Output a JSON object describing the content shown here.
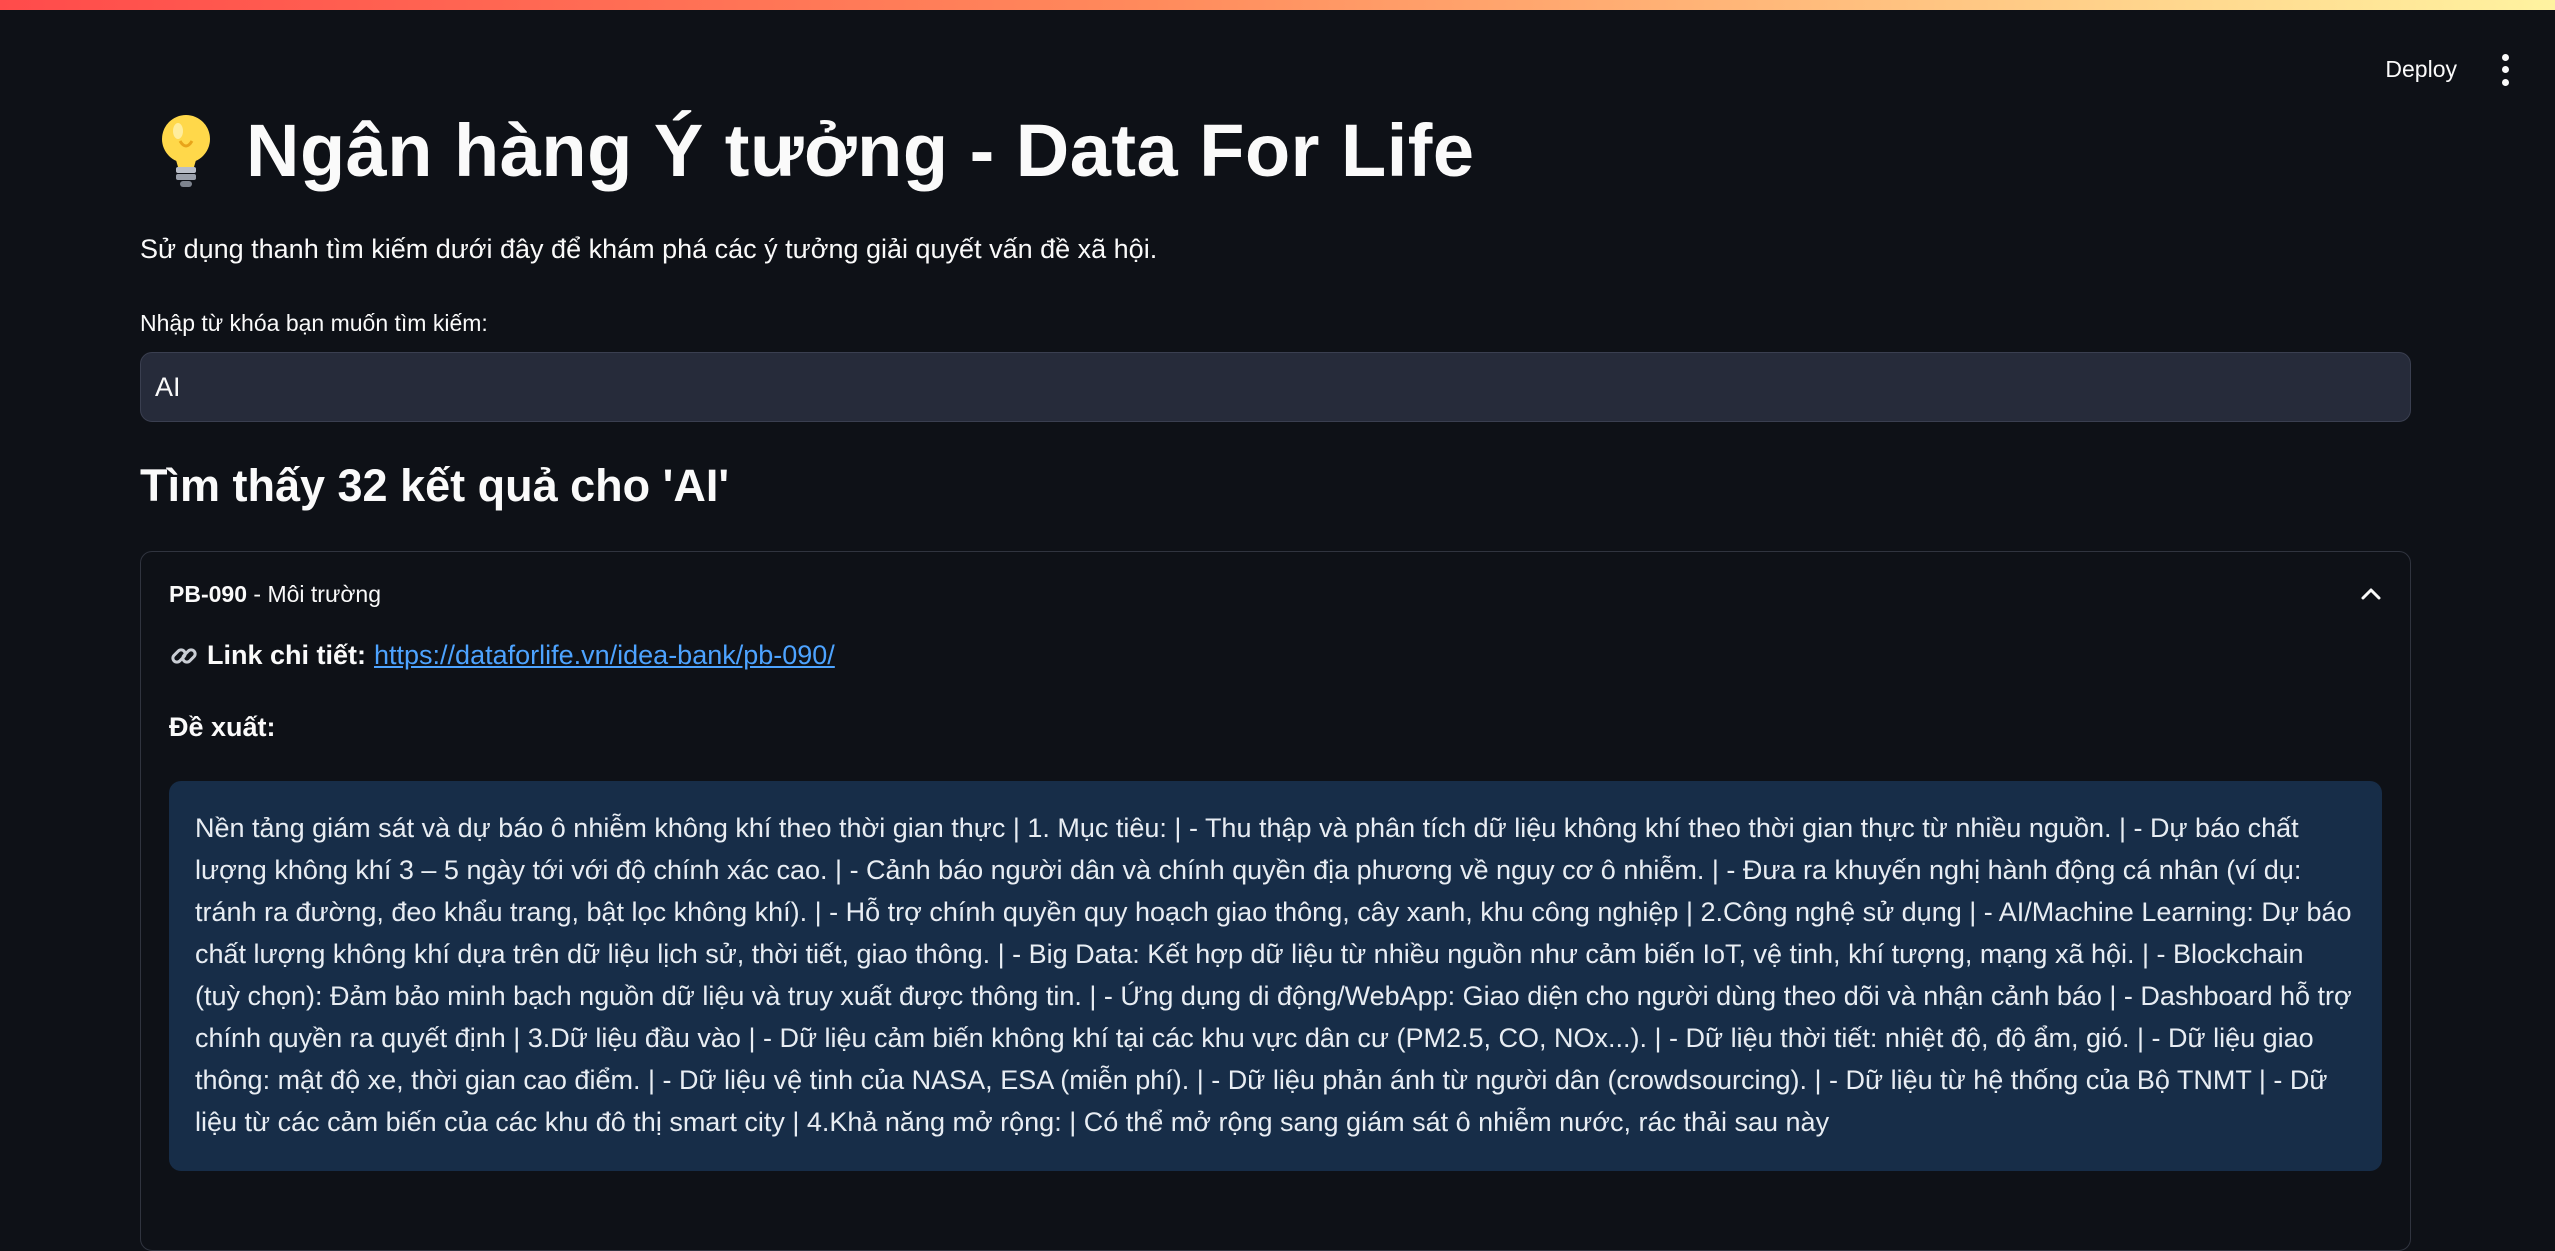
{
  "header": {
    "deploy_label": "Deploy",
    "menu_icon": "kebab-menu-icon"
  },
  "page": {
    "title_icon": "lightbulb-icon",
    "title": "Ngân hàng Ý tưởng - Data For Life",
    "description": "Sử dụng thanh tìm kiếm dưới đây để khám phá các ý tưởng giải quyết vấn đề xã hội."
  },
  "search": {
    "label": "Nhập từ khóa bạn muốn tìm kiếm:",
    "value": "AI"
  },
  "results": {
    "heading": "Tìm thấy 32 kết quả cho 'AI'",
    "items": [
      {
        "id": "PB-090",
        "separator": " - ",
        "category": "Môi trường",
        "expanded": true,
        "link_label": "Link chi tiết:",
        "link_url": "https://dataforlife.vn/idea-bank/pb-090/",
        "proposal_label": "Đề xuất:",
        "proposal_text": "Nền tảng giám sát và dự báo ô nhiễm không khí theo thời gian thực | 1. Mục tiêu: | - Thu thập và phân tích dữ liệu không khí theo thời gian thực từ nhiều nguồn. | - Dự báo chất lượng không khí 3 – 5 ngày tới với độ chính xác cao. | - Cảnh báo người dân và chính quyền địa phương về nguy cơ ô nhiễm. | - Đưa ra khuyến nghị hành động cá nhân (ví dụ: tránh ra đường, đeo khẩu trang, bật lọc không khí). | - Hỗ trợ chính quyền quy hoạch giao thông, cây xanh, khu công nghiệp | 2.Công nghệ sử dụng | - AI/Machine Learning: Dự báo chất lượng không khí dựa trên dữ liệu lịch sử, thời tiết, giao thông. | - Big Data: Kết hợp dữ liệu từ nhiều nguồn như cảm biến IoT, vệ tinh, khí tượng, mạng xã hội. | - Blockchain (tuỳ chọn): Đảm bảo minh bạch nguồn dữ liệu và truy xuất được thông tin. | - Ứng dụng di động/WebApp: Giao diện cho người dùng theo dõi và nhận cảnh báo | - Dashboard hỗ trợ chính quyền ra quyết định | 3.Dữ liệu đầu vào | - Dữ liệu cảm biến không khí tại các khu vực dân cư (PM2.5, CO, NOx...). | - Dữ liệu thời tiết: nhiệt độ, độ ẩm, gió. | - Dữ liệu giao thông: mật độ xe, thời gian cao điểm. | - Dữ liệu vệ tinh của NASA, ESA (miễn phí). | - Dữ liệu phản ánh từ người dân (crowdsourcing). | - Dữ liệu từ hệ thống của Bộ TNMT | - Dữ liệu từ các cảm biến của các khu đô thị smart city | 4.Khả năng mở rộng: | Có thể mở rộng sang giám sát ô nhiễm nước, rác thải sau này"
      }
    ]
  }
}
